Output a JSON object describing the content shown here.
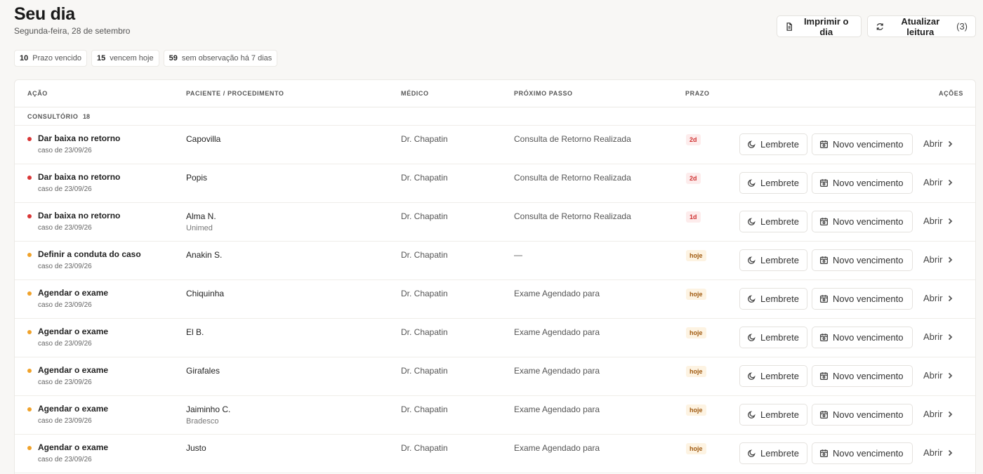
{
  "header": {
    "title": "Seu dia",
    "subtitle": "Segunda-feira, 28 de setembro",
    "print_label": "Imprimir o dia",
    "refresh_label": "Atualizar leitura",
    "refresh_count": "(3)"
  },
  "stats": [
    {
      "num": "10",
      "label": "Prazo vencido"
    },
    {
      "num": "15",
      "label": "vencem hoje"
    },
    {
      "num": "59",
      "label": "sem observação há 7 dias"
    }
  ],
  "table": {
    "columns": {
      "acao": "AÇÃO",
      "paciente": "PACIENTE / PROCEDIMENTO",
      "medico": "MÉDICO",
      "proximo": "PRÓXIMO PASSO",
      "prazo": "PRAZO",
      "acoes": "AÇÕES"
    },
    "group": {
      "label": "CONSULTÓRIO",
      "count": "18"
    },
    "buttons": {
      "lembrete": "Lembrete",
      "novo": "Novo vencimento",
      "abrir": "Abrir"
    },
    "rows": [
      {
        "status": "late",
        "title": "Dar baixa no retorno",
        "sub": "caso de 23/09/26",
        "patient": "Capovilla",
        "patient_sub": "",
        "doctor": "Dr. Chapatin",
        "next": "Consulta de Retorno Realizada",
        "deadline": "2d"
      },
      {
        "status": "late",
        "title": "Dar baixa no retorno",
        "sub": "caso de 23/09/26",
        "patient": "Popis",
        "patient_sub": "",
        "doctor": "Dr. Chapatin",
        "next": "Consulta de Retorno Realizada",
        "deadline": "2d"
      },
      {
        "status": "late",
        "title": "Dar baixa no retorno",
        "sub": "caso de 23/09/26",
        "patient": "Alma N.",
        "patient_sub": "Unimed",
        "doctor": "Dr. Chapatin",
        "next": "Consulta de Retorno Realizada",
        "deadline": "1d"
      },
      {
        "status": "today",
        "title": "Definir a conduta do caso",
        "sub": "caso de 23/09/26",
        "patient": "Anakin S.",
        "patient_sub": "",
        "doctor": "Dr. Chapatin",
        "next": "—",
        "deadline": "hoje"
      },
      {
        "status": "today",
        "title": "Agendar o exame",
        "sub": "caso de 23/09/26",
        "patient": "Chiquinha",
        "patient_sub": "",
        "doctor": "Dr. Chapatin",
        "next": "Exame Agendado para",
        "deadline": "hoje"
      },
      {
        "status": "today",
        "title": "Agendar o exame",
        "sub": "caso de 23/09/26",
        "patient": "El B.",
        "patient_sub": "",
        "doctor": "Dr. Chapatin",
        "next": "Exame Agendado para",
        "deadline": "hoje"
      },
      {
        "status": "today",
        "title": "Agendar o exame",
        "sub": "caso de 23/09/26",
        "patient": "Girafales",
        "patient_sub": "",
        "doctor": "Dr. Chapatin",
        "next": "Exame Agendado para",
        "deadline": "hoje"
      },
      {
        "status": "today",
        "title": "Agendar o exame",
        "sub": "caso de 23/09/26",
        "patient": "Jaiminho C.",
        "patient_sub": "Bradesco",
        "doctor": "Dr. Chapatin",
        "next": "Exame Agendado para",
        "deadline": "hoje"
      },
      {
        "status": "today",
        "title": "Agendar o exame",
        "sub": "caso de 23/09/26",
        "patient": "Justo",
        "patient_sub": "",
        "doctor": "Dr. Chapatin",
        "next": "Exame Agendado para",
        "deadline": "hoje"
      }
    ]
  }
}
